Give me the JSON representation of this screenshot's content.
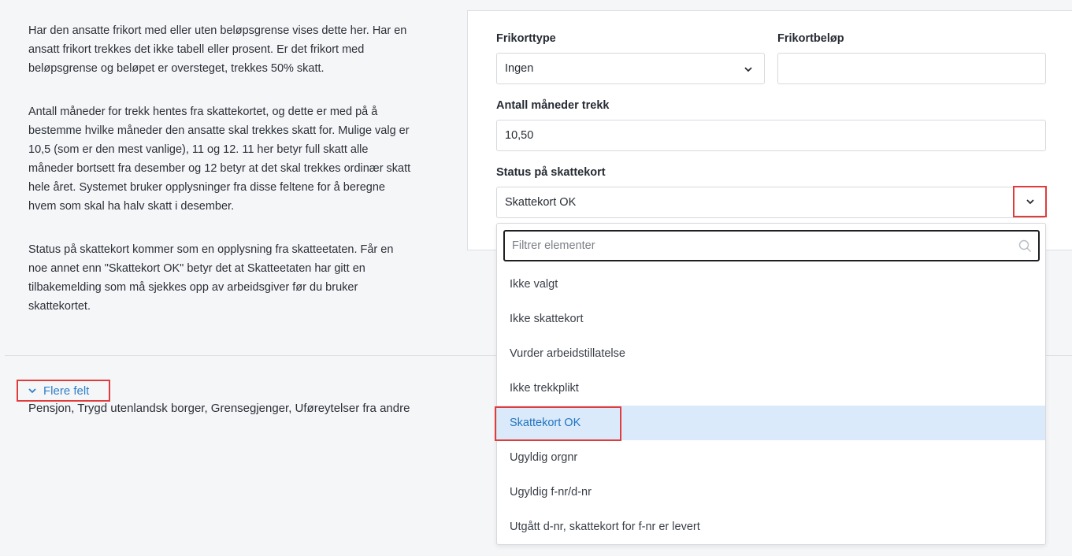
{
  "help": {
    "para1": "Har den ansatte frikort med eller uten beløpsgrense vises dette her. Har en ansatt frikort trekkes det ikke tabell eller prosent. Er det frikort med beløpsgrense og beløpet er oversteget, trekkes 50% skatt.",
    "para2": "Antall måneder for trekk hentes fra skattekortet, og dette er med på å bestemme hvilke måneder den ansatte skal trekkes skatt for. Mulige valg er 10,5 (som er den mest vanlige), 11 og 12. 11 her betyr full skatt alle måneder bortsett fra desember og 12 betyr at det skal trekkes ordinær skatt hele året. Systemet bruker opplysninger fra disse feltene for å beregne hvem som skal ha halv skatt i desember.",
    "para3": "Status på skattekort kommer som en opplysning fra skatteetaten. Får en noe annet enn \"Skattekort OK\" betyr det at Skatteetaten har gitt en tilbakemelding som må sjekkes opp av arbeidsgiver før du bruker skattekortet."
  },
  "more_fields": {
    "label": "Flere felt",
    "description": "Pensjon, Trygd utenlandsk borger, Grensegjenger, Uføreytelser fra andre"
  },
  "form": {
    "frikorttype": {
      "label": "Frikorttype",
      "value": "Ingen"
    },
    "frikortbelop": {
      "label": "Frikortbeløp",
      "value": ""
    },
    "antall_maneder": {
      "label": "Antall måneder trekk",
      "value": "10,50"
    },
    "status": {
      "label": "Status på skattekort",
      "value": "Skattekort OK"
    }
  },
  "dropdown": {
    "filter_placeholder": "Filtrer elementer",
    "options": [
      "Ikke valgt",
      "Ikke skattekort",
      "Vurder arbeidstillatelse",
      "Ikke trekkplikt",
      "Skattekort OK",
      "Ugyldig orgnr",
      "Ugyldig f-nr/d-nr",
      "Utgått d-nr, skattekort for f-nr er levert"
    ],
    "selected": "Skattekort OK"
  },
  "colors": {
    "accent": "#2f7fc7",
    "highlight_border": "#e03c3c",
    "selected_bg": "#daeafa"
  }
}
